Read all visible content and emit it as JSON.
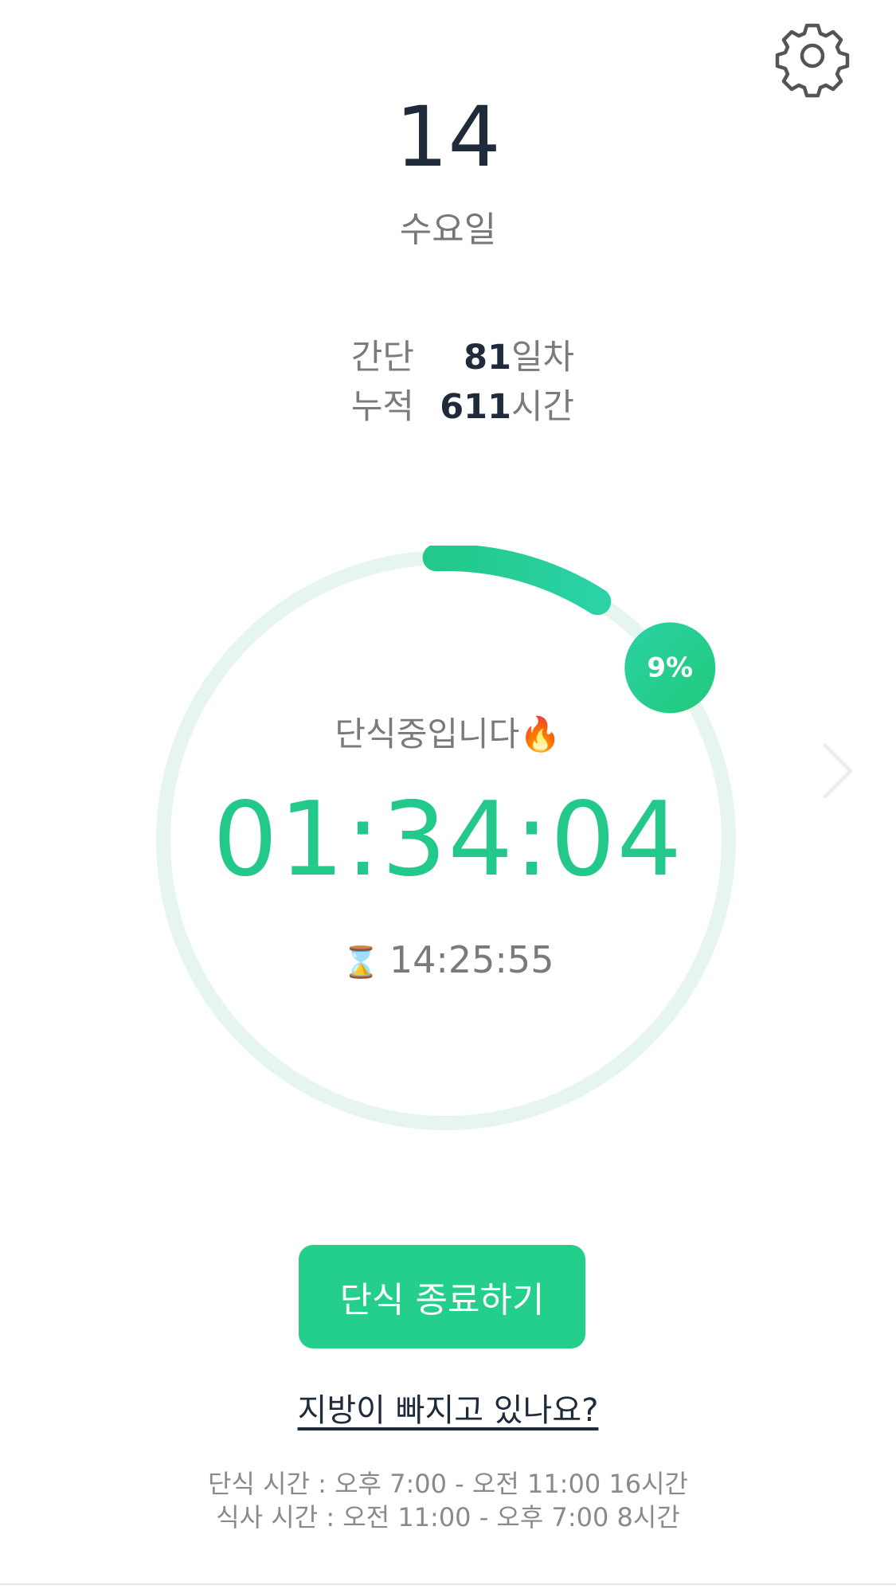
{
  "header": {
    "date_number": "14",
    "weekday": "수요일",
    "settings_icon": "gear-icon"
  },
  "stats": {
    "days_label": "간단",
    "days_value": "81",
    "days_unit": "일차",
    "hours_label": "누적",
    "hours_value": "611",
    "hours_unit": "시간"
  },
  "timer": {
    "progress_percent": 9,
    "progress_label": "9%",
    "status_text": "단식중입니다🔥",
    "elapsed": "01:34:04",
    "remaining_icon": "hourglass-icon",
    "remaining": "14:25:55",
    "next_icon": "chevron-right-icon"
  },
  "actions": {
    "end_fast_label": "단식 종료하기",
    "fat_link_label": "지방이 빠지고 있나요?"
  },
  "schedule": {
    "fast_line": "단식 시간 : 오후 7:00 - 오전 11:00 16시간",
    "eat_line": "식사 시간 : 오전 11:00 - 오후 7:00 8시간"
  },
  "colors": {
    "accent": "#23cf8b",
    "ring_track": "#e6f6ee",
    "text_dark": "#1f2a3a",
    "text_muted": "#7b7b7b"
  }
}
